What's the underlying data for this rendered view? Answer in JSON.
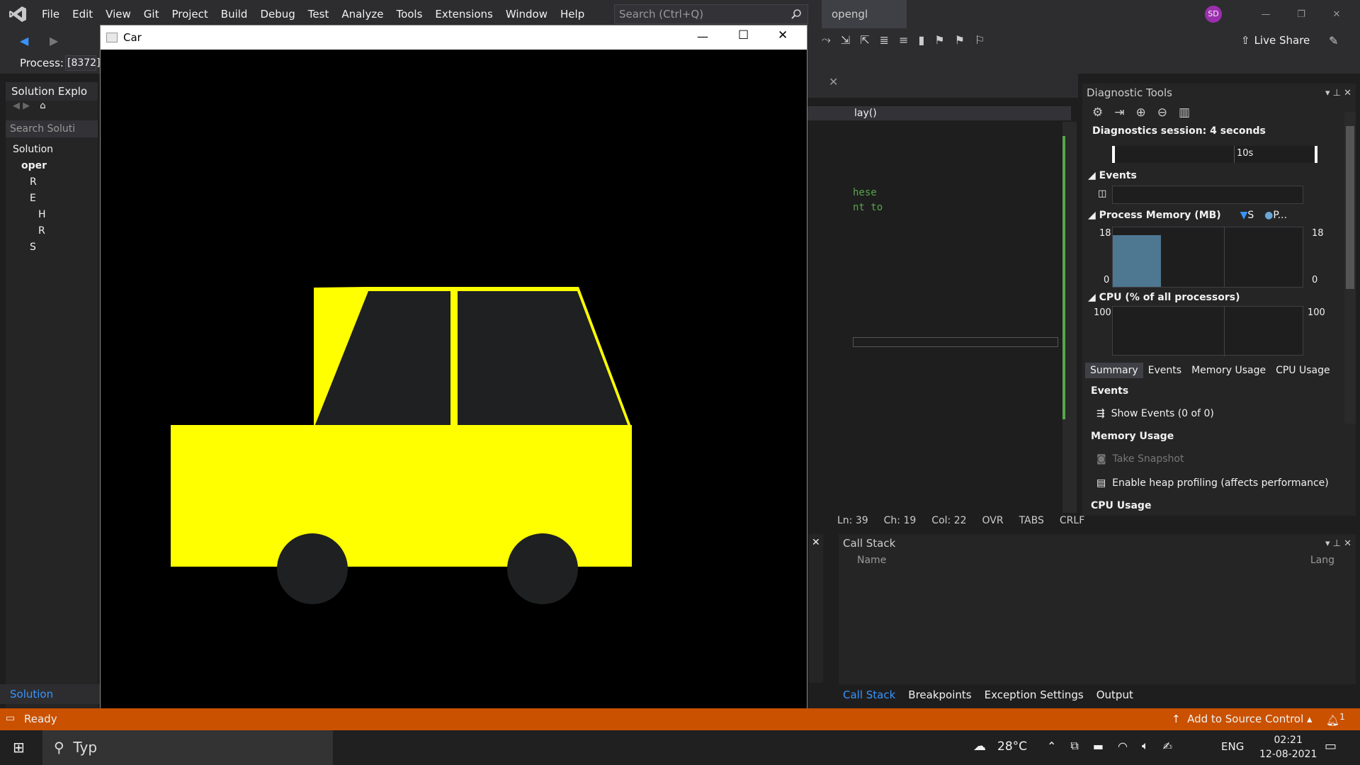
{
  "vs": {
    "menu": [
      "File",
      "Edit",
      "View",
      "Git",
      "Project",
      "Build",
      "Debug",
      "Test",
      "Analyze",
      "Tools",
      "Extensions",
      "Window",
      "Help"
    ],
    "search_placeholder": "Search (Ctrl+Q)",
    "solution_name": "opengl",
    "avatar_initials": "SD",
    "live_share": "Live Share",
    "process_label": "Process:",
    "process_value": "[8372]"
  },
  "solution_explorer": {
    "title": "Solution Explo",
    "search": "Search Soluti",
    "items": [
      "Solution",
      "oper",
      "R",
      "E",
      "H",
      "R",
      "S"
    ],
    "bottom_tab": "Solution Explorer"
  },
  "car_window": {
    "title": "Car",
    "car_body_color": "#ffff00",
    "car_window_color": "#1e2021",
    "wheel_color": "#1e2021"
  },
  "editor": {
    "nav_text": "lay()",
    "code_lines": [
      "hese",
      "nt to"
    ],
    "status": {
      "ln": "Ln: 39",
      "ch": "Ch: 19",
      "col": "Col: 22",
      "ovr": "OVR",
      "tabs": "TABS",
      "crlf": "CRLF"
    }
  },
  "diagnostic": {
    "title": "Diagnostic Tools",
    "session": "Diagnostics session: 4 seconds",
    "timeline_label": "10s",
    "events_section": "Events",
    "memory_section": "Process Memory (MB)",
    "memory_legend_a": "S",
    "memory_legend_b": "P...",
    "mem_max_left": "18",
    "mem_min_left": "0",
    "mem_max_right": "18",
    "mem_min_right": "0",
    "memory_level": 0.87,
    "cpu_section": "CPU (% of all processors)",
    "cpu_left": "100",
    "cpu_right": "100",
    "tabs": [
      "Summary",
      "Events",
      "Memory Usage",
      "CPU Usage"
    ],
    "summary_events": "Events",
    "show_events": "Show Events (0 of 0)",
    "summary_memory": "Memory Usage",
    "take_snapshot": "Take Snapshot",
    "heap_profiling": "Enable heap profiling (affects performance)",
    "summary_cpu": "CPU Usage"
  },
  "call_stack": {
    "title": "Call Stack",
    "col_name": "Name",
    "col_lang": "Lang",
    "bottom_tabs": [
      "Call Stack",
      "Breakpoints",
      "Exception Settings",
      "Output"
    ]
  },
  "statusbar": {
    "ready": "Ready",
    "source_control": "Add to Source Control",
    "notif_count": "1"
  },
  "taskbar": {
    "search_text": "Typ",
    "temperature": "28°C",
    "lang": "ENG",
    "time": "02:21",
    "date": "12-08-2021"
  }
}
